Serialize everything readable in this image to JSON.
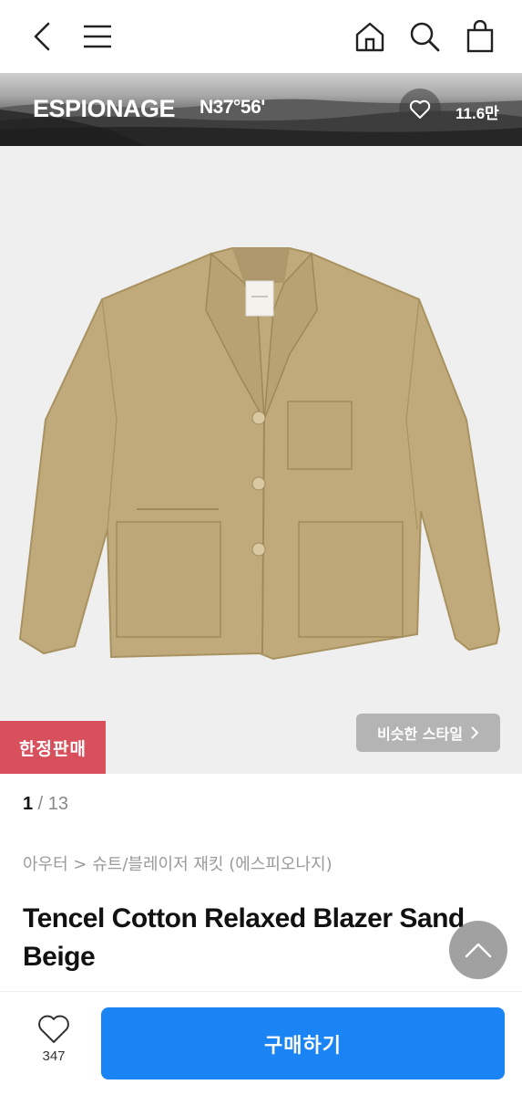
{
  "nav": {
    "back_icon": "chevron-left-icon",
    "menu_icon": "hamburger-menu-icon",
    "home_icon": "home-icon",
    "search_icon": "search-icon",
    "cart_icon": "shopping-bag-icon"
  },
  "brand": {
    "name": "ESPIONAGE",
    "sub": "N37°56'",
    "like_icon": "heart-outline-icon",
    "like_count": "11.6만"
  },
  "product_image": {
    "badge": "한정판매",
    "similar_label": "비슷한 스타일",
    "similar_icon": "chevron-right-icon"
  },
  "pager": {
    "current": "1",
    "separator": " / ",
    "total": "13"
  },
  "breadcrumb": "아우터 > 슈트/블레이저 재킷 (에스피오나지)",
  "title": "Tencel Cotton Relaxed Blazer Sand Beige",
  "scroll_top_icon": "chevron-up-icon",
  "bottom": {
    "like_icon": "heart-outline-icon",
    "like_count": "347",
    "buy_label": "구매하기"
  },
  "colors": {
    "buy_button": "#1a84f5",
    "badge": "#d8505c",
    "jacket": "#c0aa7c"
  }
}
